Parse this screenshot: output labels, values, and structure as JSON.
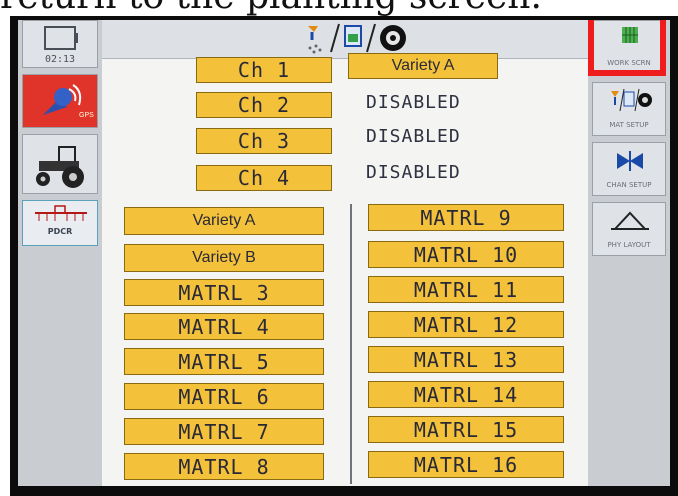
{
  "caption": "return to the planting screen.",
  "clock": "02:13",
  "left_nav": {
    "gps_label": "GPS",
    "pdcr_label": "PDCR"
  },
  "right_nav": {
    "work_scrn": "WORK SCRN",
    "mat_setup": "MAT SETUP",
    "chan_setup": "CHAN SETUP",
    "phy_layout": "PHY LAYOUT"
  },
  "channels": [
    {
      "label": "Ch 1",
      "assignment": "Variety A"
    },
    {
      "label": "Ch 2",
      "assignment": "DISABLED"
    },
    {
      "label": "Ch 3",
      "assignment": "DISABLED"
    },
    {
      "label": "Ch 4",
      "assignment": "DISABLED"
    }
  ],
  "materials_left": [
    "Variety A",
    "Variety B",
    "MATRL 3",
    "MATRL 4",
    "MATRL 5",
    "MATRL 6",
    "MATRL 7",
    "MATRL 8"
  ],
  "materials_right": [
    "MATRL 9",
    "MATRL 10",
    "MATRL 11",
    "MATRL 12",
    "MATRL 13",
    "MATRL 14",
    "MATRL 15",
    "MATRL 16"
  ],
  "colors": {
    "tag": "#f4c13b",
    "highlight": "#ee1c1c",
    "gps": "#e0332a"
  }
}
